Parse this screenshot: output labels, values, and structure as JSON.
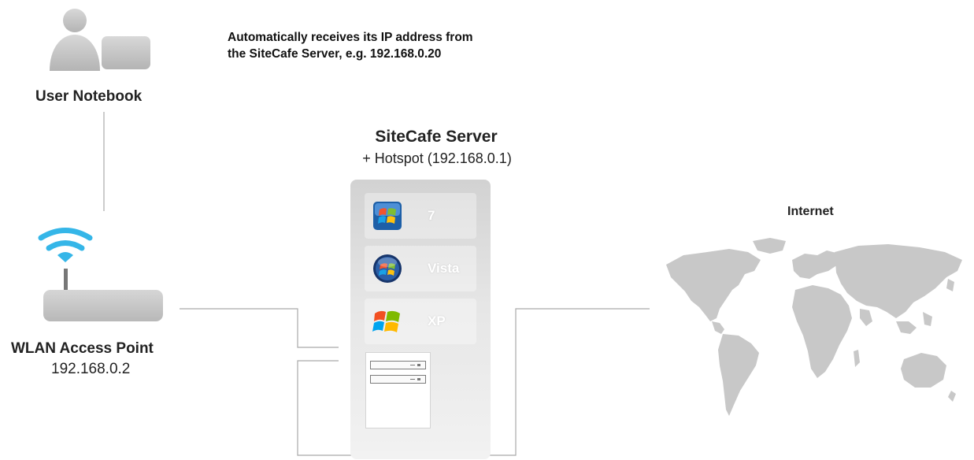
{
  "note": {
    "line1": "Automatically receives its IP address from",
    "line2": "the SiteCafe Server, e.g. 192.168.0.20"
  },
  "user_notebook": {
    "label": "User Notebook",
    "icon": "user-notebook-icon"
  },
  "access_point": {
    "label": "WLAN Access Point",
    "ip": "192.168.0.2",
    "icon": "wifi-router-icon"
  },
  "server": {
    "title": "SiteCafe Server",
    "subtitle": "+ Hotspot (192.168.0.1)",
    "os": [
      {
        "label": "7",
        "icon": "windows-7-logo"
      },
      {
        "label": "Vista",
        "icon": "windows-vista-logo"
      },
      {
        "label": "XP",
        "icon": "windows-xp-logo"
      }
    ]
  },
  "internet": {
    "label": "Internet",
    "icon": "world-map"
  },
  "colors": {
    "wifi": "#35b6e8",
    "device_gray": "#c9c9c9",
    "connector": "#a8a8a8",
    "map_gray": "#c8c8c8"
  }
}
